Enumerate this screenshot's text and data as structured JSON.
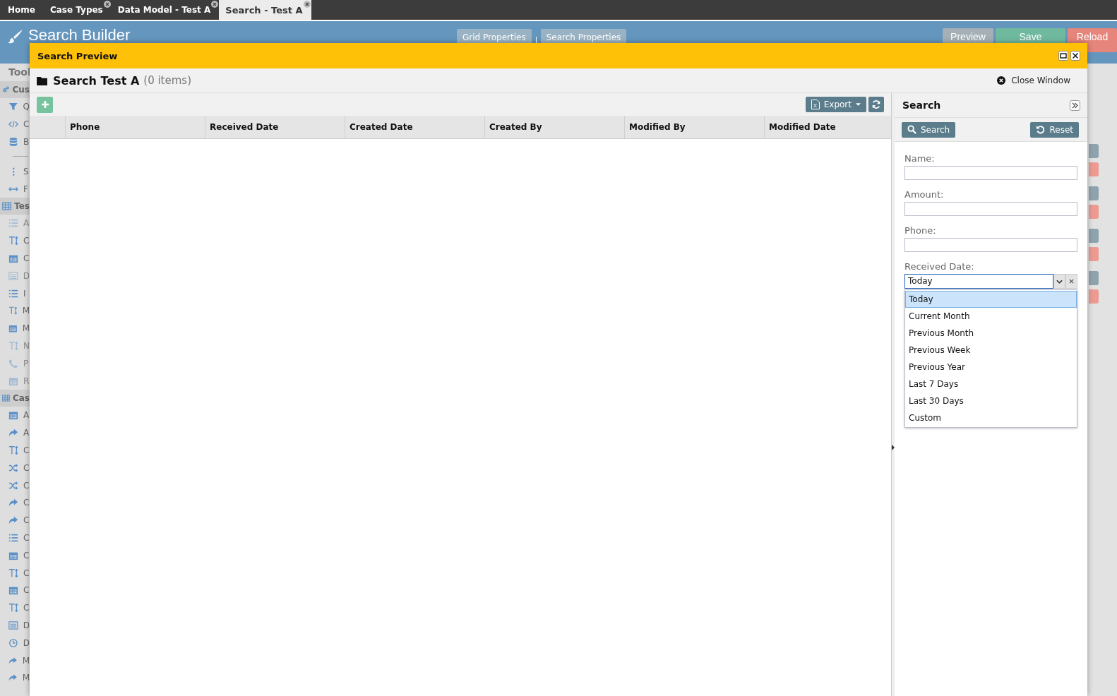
{
  "tabs": [
    {
      "label": "Home",
      "closable": false,
      "selected": false
    },
    {
      "label": "Case Types",
      "closable": true,
      "selected": false
    },
    {
      "label": "Data Model - Test A",
      "closable": true,
      "selected": false
    },
    {
      "label": "Search - Test A",
      "closable": true,
      "selected": true
    }
  ],
  "header": {
    "title": "Search Builder",
    "tabs": [
      {
        "label": "Grid Properties"
      },
      {
        "label": "Search Properties"
      }
    ],
    "buttons": [
      {
        "label": "Preview",
        "kind": "preview"
      },
      {
        "label": "Save",
        "kind": "save"
      },
      {
        "label": "Reload",
        "kind": "reload"
      }
    ]
  },
  "sidebar": {
    "title": "Tool",
    "sections": [
      {
        "label": "Cus",
        "kind": "gears",
        "items": [
          {
            "kind": "filter",
            "text": "Q",
            "disabled": false
          },
          {
            "kind": "code",
            "text": "C",
            "disabled": false
          },
          {
            "kind": "database",
            "text": "B",
            "disabled": false
          },
          {
            "kind": "divider"
          },
          {
            "kind": "ellipsis",
            "text": "S",
            "disabled": false
          },
          {
            "kind": "arrows",
            "text": "F",
            "disabled": false
          }
        ]
      },
      {
        "label": "Tes",
        "kind": "table",
        "items": [
          {
            "kind": "list",
            "text": "A",
            "disabled": true
          },
          {
            "kind": "text",
            "text": "C",
            "disabled": false
          },
          {
            "kind": "calendar",
            "text": "C",
            "disabled": false
          },
          {
            "kind": "card",
            "text": "D",
            "disabled": true
          },
          {
            "kind": "list",
            "text": "I",
            "disabled": false
          },
          {
            "kind": "text",
            "text": "M",
            "disabled": false
          },
          {
            "kind": "calendar",
            "text": "M",
            "disabled": false
          },
          {
            "kind": "text",
            "text": "N",
            "disabled": true
          },
          {
            "kind": "phone",
            "text": "P",
            "disabled": true
          },
          {
            "kind": "calendar",
            "text": "R",
            "disabled": true
          }
        ]
      },
      {
        "label": "Cas",
        "kind": "table",
        "items": [
          {
            "kind": "calendar",
            "text": "A",
            "disabled": false
          },
          {
            "kind": "share",
            "text": "A",
            "disabled": false
          },
          {
            "kind": "text",
            "text": "C",
            "disabled": false
          },
          {
            "kind": "random",
            "text": "C",
            "disabled": false
          },
          {
            "kind": "random",
            "text": "C",
            "disabled": false
          },
          {
            "kind": "share",
            "text": "C",
            "disabled": false
          },
          {
            "kind": "share",
            "text": "C",
            "disabled": false
          },
          {
            "kind": "list",
            "text": "C",
            "disabled": false
          },
          {
            "kind": "calendar",
            "text": "C",
            "disabled": false
          },
          {
            "kind": "text",
            "text": "C",
            "disabled": false
          },
          {
            "kind": "calendar",
            "text": "C",
            "disabled": false
          },
          {
            "kind": "text",
            "text": "C",
            "disabled": false
          },
          {
            "kind": "card",
            "text": "D",
            "disabled": false
          },
          {
            "kind": "clock",
            "text": "D",
            "disabled": false
          },
          {
            "kind": "share",
            "text": "M",
            "disabled": false
          },
          {
            "kind": "share",
            "text": "M",
            "disabled": false
          }
        ]
      }
    ]
  },
  "modal": {
    "title": "Search Preview",
    "heading": "Search Test A",
    "count": "(0 items)",
    "close_label": "Close Window",
    "toolbar": {
      "export_label": "Export"
    },
    "table": {
      "columns": [
        "Phone",
        "Received Date",
        "Created Date",
        "Created By",
        "Modified By",
        "Modified Date"
      ]
    },
    "search_panel": {
      "title": "Search",
      "buttons": [
        {
          "label": "Search",
          "kind": "search"
        },
        {
          "label": "Reset",
          "kind": "reset"
        }
      ],
      "fields": [
        {
          "label": "Name:",
          "kind": "text"
        },
        {
          "label": "Amount:",
          "kind": "text"
        },
        {
          "label": "Phone:",
          "kind": "text"
        },
        {
          "label": "Received Date:",
          "kind": "dropdown",
          "value": "Today",
          "expanded": true,
          "options": [
            {
              "label": "Today",
              "selected": true
            },
            {
              "label": "Current Month",
              "selected": false
            },
            {
              "label": "Previous Month",
              "selected": false
            },
            {
              "label": "Previous Week",
              "selected": false
            },
            {
              "label": "Previous Year",
              "selected": false
            },
            {
              "label": "Last 7 Days",
              "selected": false
            },
            {
              "label": "Last 30 Days",
              "selected": false
            },
            {
              "label": "Custom",
              "selected": false
            }
          ]
        }
      ]
    }
  }
}
